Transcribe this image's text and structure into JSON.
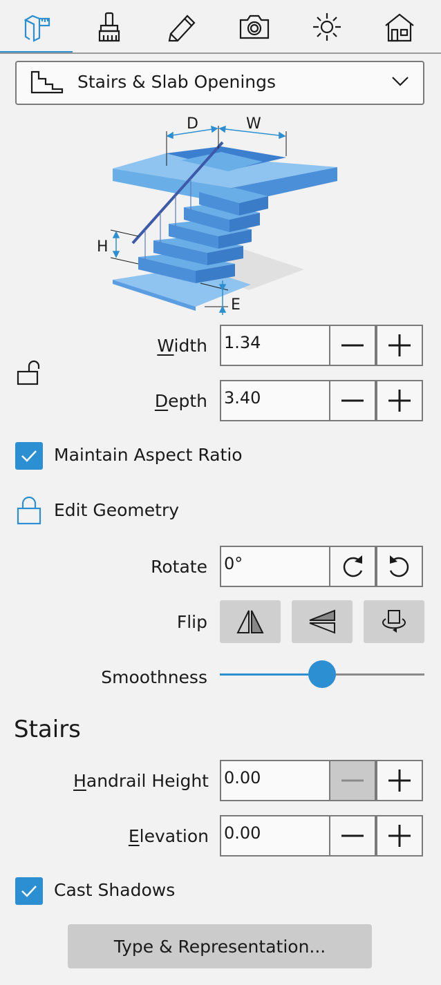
{
  "tabs": [
    {
      "icon": "measure-icon",
      "active": true
    },
    {
      "icon": "paint-brush-icon",
      "active": false
    },
    {
      "icon": "pencil-icon",
      "active": false
    },
    {
      "icon": "camera-icon",
      "active": false
    },
    {
      "icon": "sun-icon",
      "active": false
    },
    {
      "icon": "house-icon",
      "active": false
    }
  ],
  "object_type": {
    "label": "Stairs & Slab Openings",
    "icon": "stairs-icon"
  },
  "illustration": {
    "label_d": "D",
    "label_w": "W",
    "label_h": "H",
    "label_e": "E"
  },
  "dimensions": {
    "width_label_prefix": "W",
    "width_label_rest": "idth",
    "width_value": "1.34",
    "depth_label_prefix": "D",
    "depth_label_rest": "epth",
    "depth_value": "3.40",
    "lock_icon": "unlocked-icon"
  },
  "maintain_aspect_ratio": {
    "label": "Maintain Aspect Ratio",
    "checked": true
  },
  "edit_geometry": {
    "label": "Edit Geometry",
    "icon": "lock-icon"
  },
  "rotate": {
    "label": "Rotate",
    "value": "0°"
  },
  "flip": {
    "label": "Flip"
  },
  "smoothness": {
    "label": "Smoothness",
    "value": 0.5
  },
  "stairs": {
    "title": "Stairs",
    "handrail_prefix": "H",
    "handrail_rest": "andrail Height",
    "handrail_value": "0.00",
    "elevation_prefix": "E",
    "elevation_rest": "levation",
    "elevation_value": "0.00"
  },
  "cast_shadows": {
    "label": "Cast Shadows",
    "checked": true
  },
  "type_button": {
    "label": "Type & Representation..."
  },
  "colors": {
    "accent": "#2b8fd1",
    "stairs_blue": "#6aaee8"
  }
}
